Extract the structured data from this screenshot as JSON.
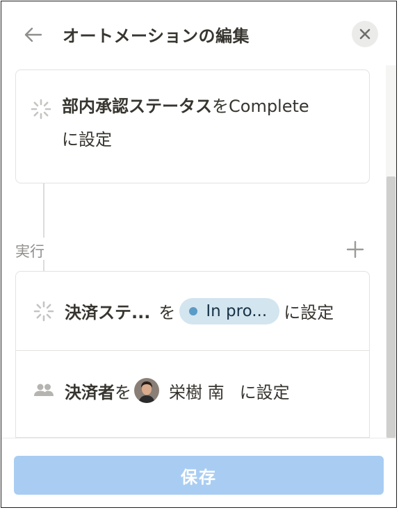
{
  "header": {
    "title": "オートメーションの編集",
    "back_icon": "arrow-left-icon",
    "close_icon": "close-icon"
  },
  "trigger": {
    "icon": "spinner-icon",
    "property": "部内承認ステータス",
    "particle": "を",
    "value": "Complete",
    "suffix": "に設定"
  },
  "actions_section": {
    "label": "実行",
    "add_icon": "plus-icon"
  },
  "actions": [
    {
      "icon": "spinner-icon",
      "property": "決済ステ...",
      "particle": "を",
      "status_value": "In pro...",
      "status_color": "#d3e5ef",
      "status_dot_color": "#5a9bc7",
      "suffix": "に設定"
    },
    {
      "icon": "people-icon",
      "property": "決済者",
      "particle": "を",
      "person_name": "栄樹 南",
      "suffix": "に設定"
    }
  ],
  "footer": {
    "save_label": "保存"
  },
  "colors": {
    "save_button": "#a9cdf2",
    "text": "#37352f",
    "muted": "#8f8e8b"
  }
}
